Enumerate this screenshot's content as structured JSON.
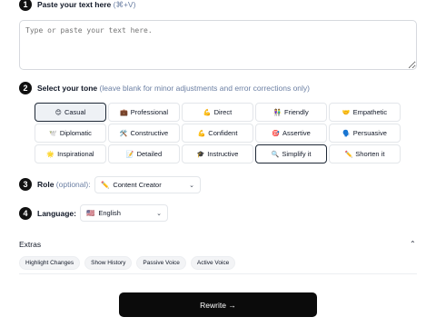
{
  "step1": {
    "number": "1",
    "title": "Paste your text here",
    "shortcut": "(⌘+V)",
    "placeholder": "Type or paste your text here."
  },
  "step2": {
    "number": "2",
    "title": "Select your tone",
    "hint": "(leave blank for minor adjustments and error corrections only)",
    "tones": [
      {
        "icon": "😊",
        "label": "Casual",
        "state": "selected"
      },
      {
        "icon": "💼",
        "label": "Professional",
        "state": ""
      },
      {
        "icon": "💪",
        "label": "Direct",
        "state": ""
      },
      {
        "icon": "👫",
        "label": "Friendly",
        "state": ""
      },
      {
        "icon": "🤝",
        "label": "Empathetic",
        "state": ""
      },
      {
        "icon": "🕊️",
        "label": "Diplomatic",
        "state": ""
      },
      {
        "icon": "🛠️",
        "label": "Constructive",
        "state": ""
      },
      {
        "icon": "💪",
        "label": "Confident",
        "state": ""
      },
      {
        "icon": "🎯",
        "label": "Assertive",
        "state": ""
      },
      {
        "icon": "🗣️",
        "label": "Persuasive",
        "state": ""
      },
      {
        "icon": "🌟",
        "label": "Inspirational",
        "state": ""
      },
      {
        "icon": "📝",
        "label": "Detailed",
        "state": ""
      },
      {
        "icon": "🎓",
        "label": "Instructive",
        "state": ""
      },
      {
        "icon": "🔍",
        "label": "Simplify it",
        "state": "hovered"
      },
      {
        "icon": "✏️",
        "label": "Shorten it",
        "state": ""
      }
    ]
  },
  "step3": {
    "number": "3",
    "title": "Role",
    "hint": "(optional):",
    "value": "Content Creator",
    "icon": "✏️",
    "chevron": "⌄"
  },
  "step4": {
    "number": "4",
    "title": "Language:",
    "value": "English",
    "icon": "🇺🇸",
    "chevron": "⌄"
  },
  "extras": {
    "title": "Extras",
    "chevron": "⌃",
    "chips": [
      "Highlight Changes",
      "Show History",
      "Passive Voice",
      "Active Voice"
    ]
  },
  "rewrite_label": "Rewrite →"
}
